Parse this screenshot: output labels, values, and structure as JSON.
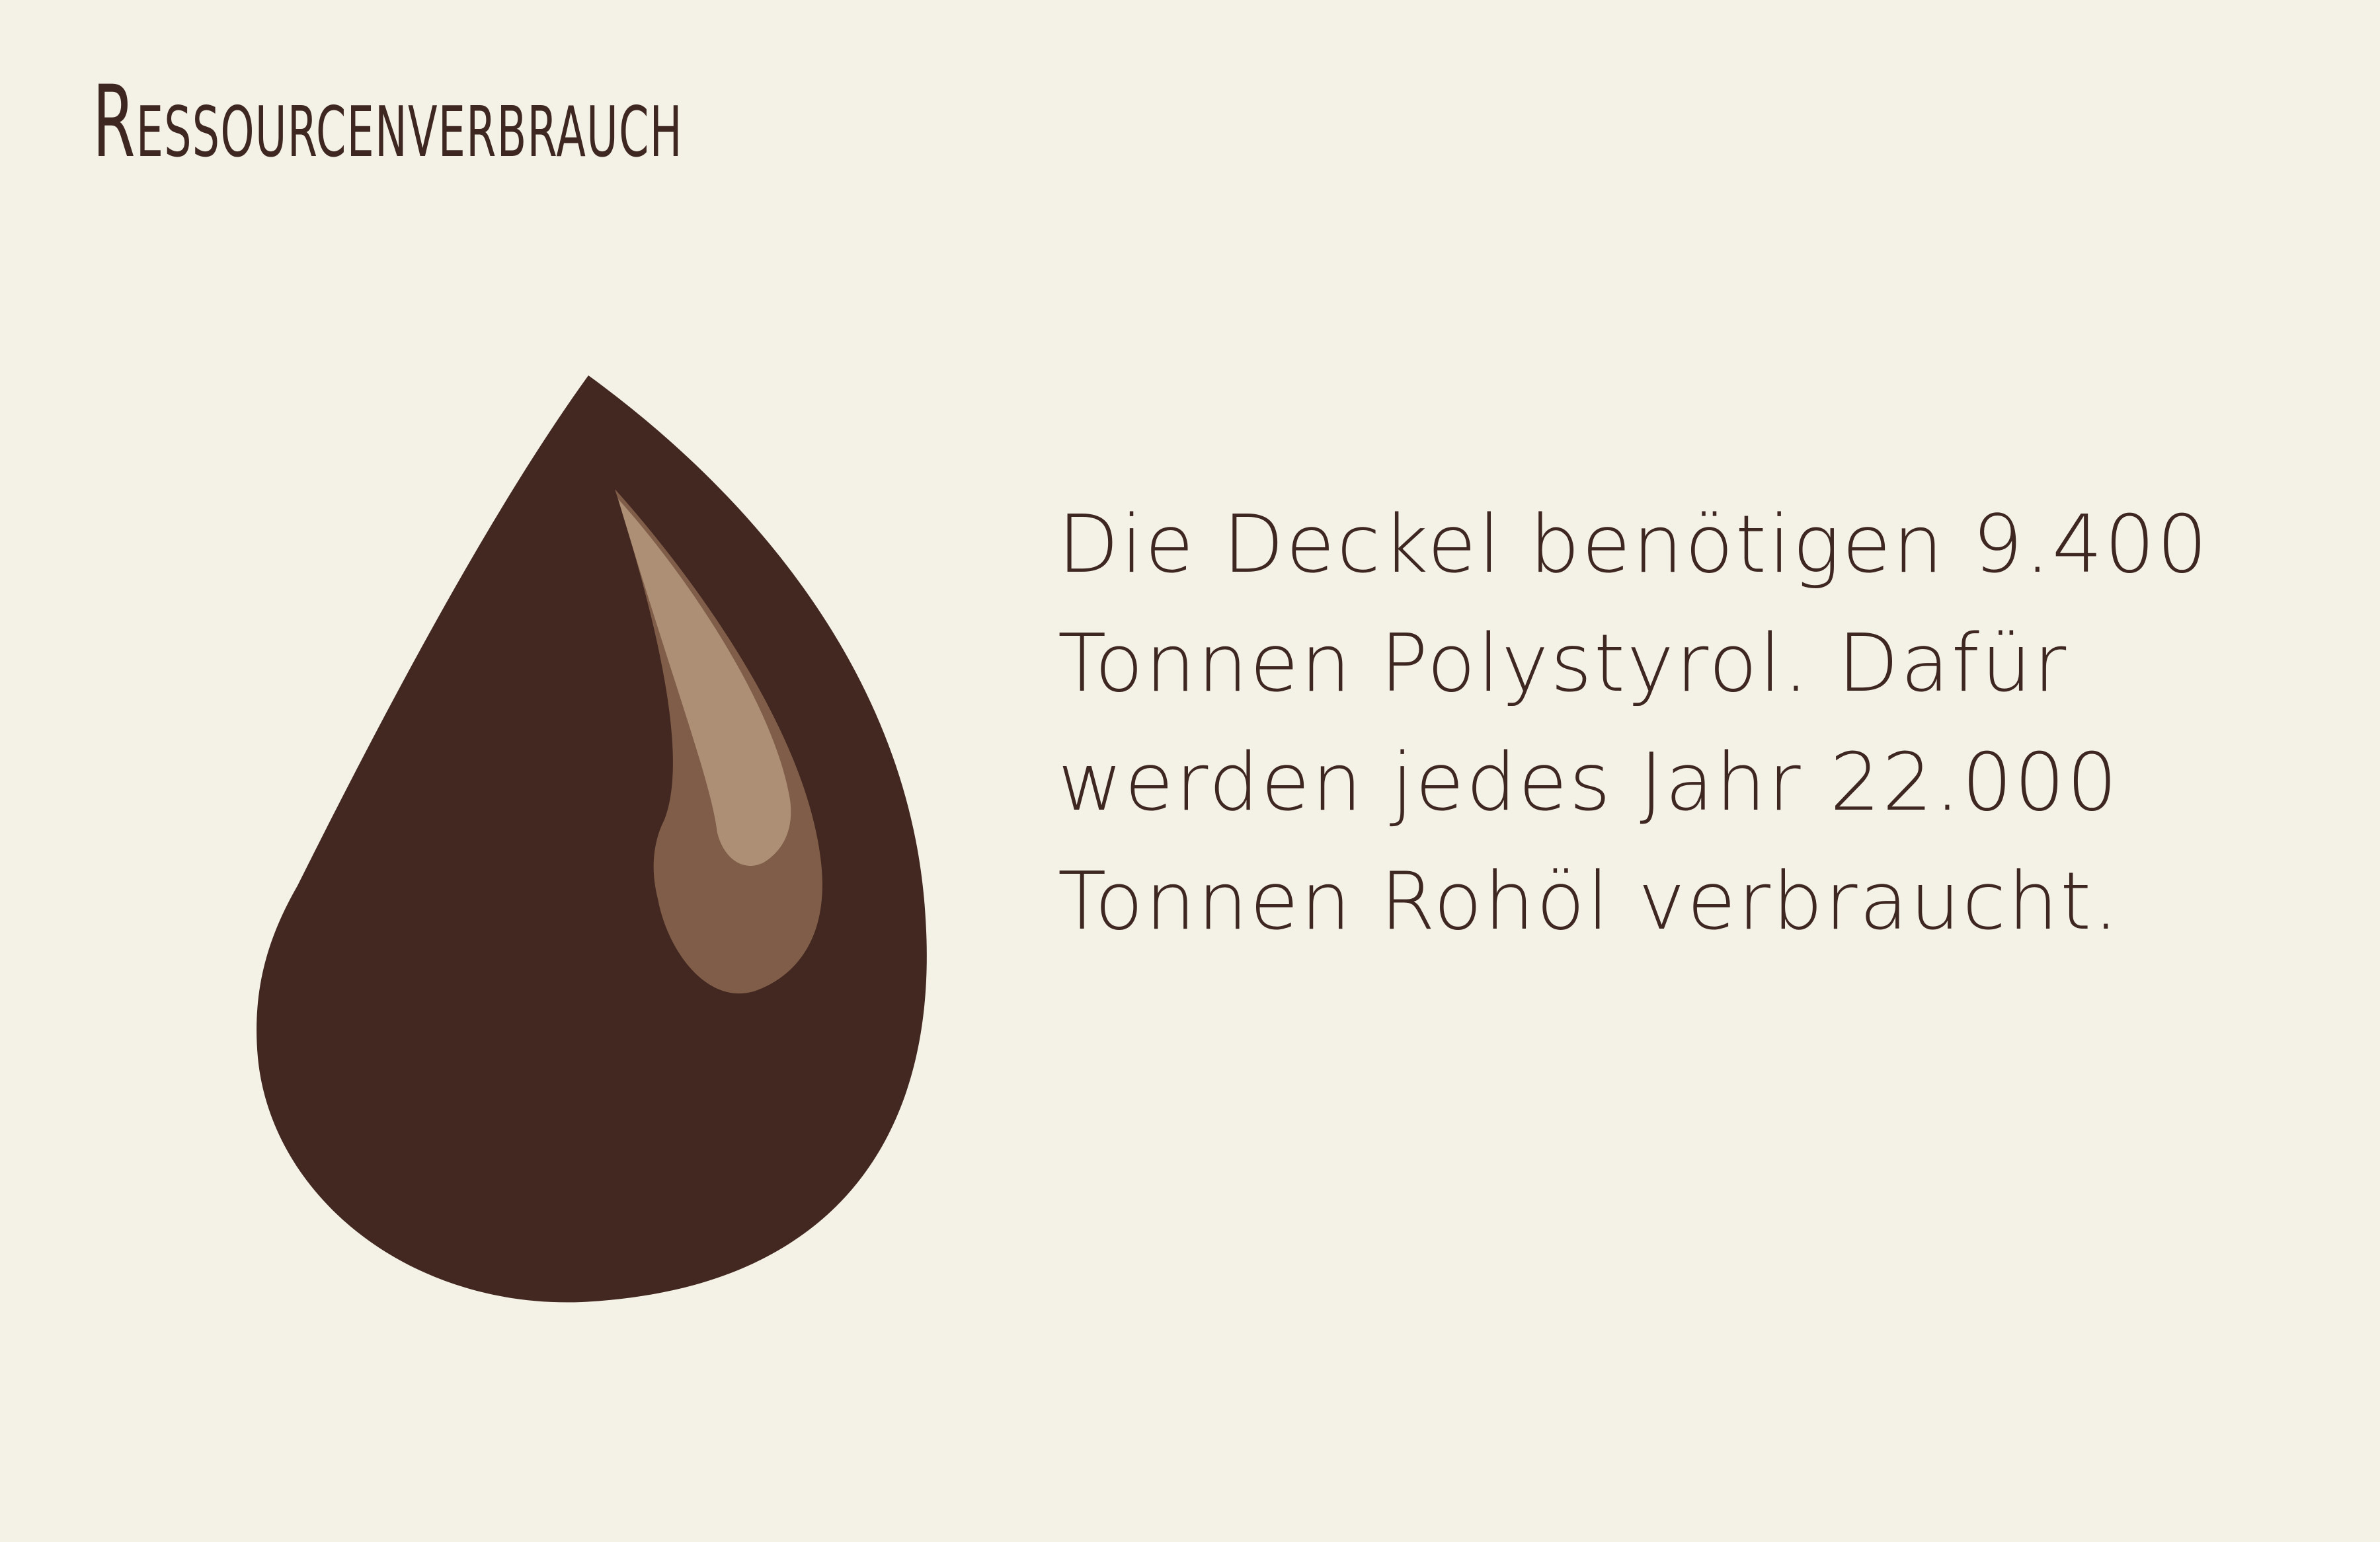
{
  "page": {
    "title": "Ressourcenverbrauch",
    "background_color": "#f4f2e6",
    "text_color": "#3e2621"
  },
  "illustration": {
    "icon": "oil-drop-icon",
    "colors": {
      "drop": "#432821",
      "highlight_dark": "#7f5d48",
      "highlight_light": "#ad8f75"
    }
  },
  "body": {
    "lines": [
      "Die Deckel benötigen 9.400",
      "Tonnen Polystyrol. Dafür",
      "werden jedes Jahr 22.000",
      "Tonnen Rohöl verbraucht."
    ]
  }
}
